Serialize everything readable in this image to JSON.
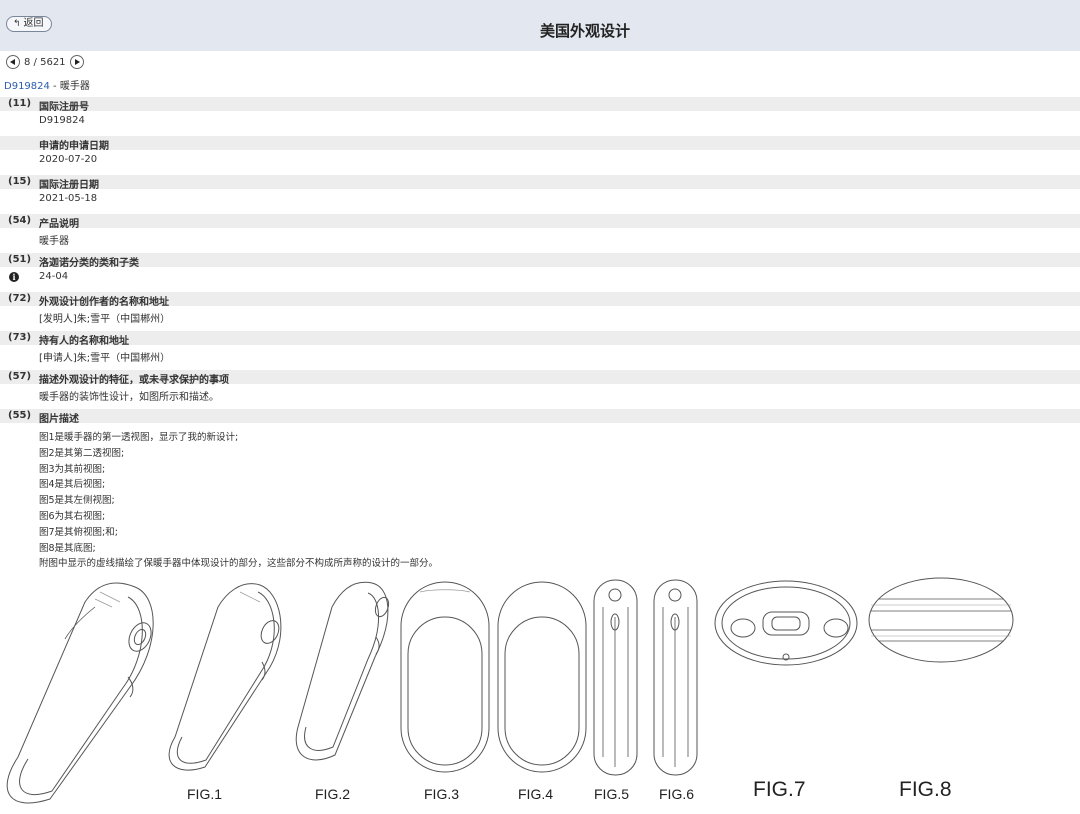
{
  "header": {
    "back_label": "返回",
    "title": "美国外观设计"
  },
  "pager": {
    "text": "8 / 5621"
  },
  "record": {
    "number": "D919824",
    "separator": " - ",
    "name": "暖手器"
  },
  "fields": [
    {
      "code": "(11)",
      "label": "国际注册号",
      "value": "D919824"
    },
    {
      "code": "",
      "label": "申请的申请日期",
      "value": "2020-07-20"
    },
    {
      "code": "(15)",
      "label": "国际注册日期",
      "value": "2021-05-18"
    },
    {
      "code": "(54)",
      "label": "产品说明",
      "value": "暖手器"
    },
    {
      "code": "(51)",
      "label": "洛迦诺分类的类和子类",
      "value": "24-04"
    },
    {
      "code": "(72)",
      "label": "外观设计创作者的名称和地址",
      "value": "[发明人]朱;雪平（中国郴州）"
    },
    {
      "code": "(73)",
      "label": "持有人的名称和地址",
      "value": "[申请人]朱;雪平（中国郴州）"
    },
    {
      "code": "(57)",
      "label": "描述外观设计的特征，或未寻求保护的事项",
      "value": "暖手器的装饰性设计，如图所示和描述。"
    },
    {
      "code": "(55)",
      "label": "图片描述"
    }
  ],
  "figure_descriptions": [
    "图1是暖手器的第一透视图，显示了我的新设计;",
    "图2是其第二透视图;",
    "图3为其前视图;",
    "图4是其后视图;",
    "图5是其左侧视图;",
    "图6为其右视图;",
    "图7是其俯视图;和;",
    "图8是其底图;",
    "附图中显示的虚线描绘了保暖手器中体现设计的部分，这些部分不构成所声称的设计的一部分。"
  ],
  "figures": {
    "fig1": "FIG.1",
    "fig2": "FIG.2",
    "fig3": "FIG.3",
    "fig4": "FIG.4",
    "fig5": "FIG.5",
    "fig6": "FIG.6",
    "fig7": "FIG.7",
    "fig8": "FIG.8"
  }
}
